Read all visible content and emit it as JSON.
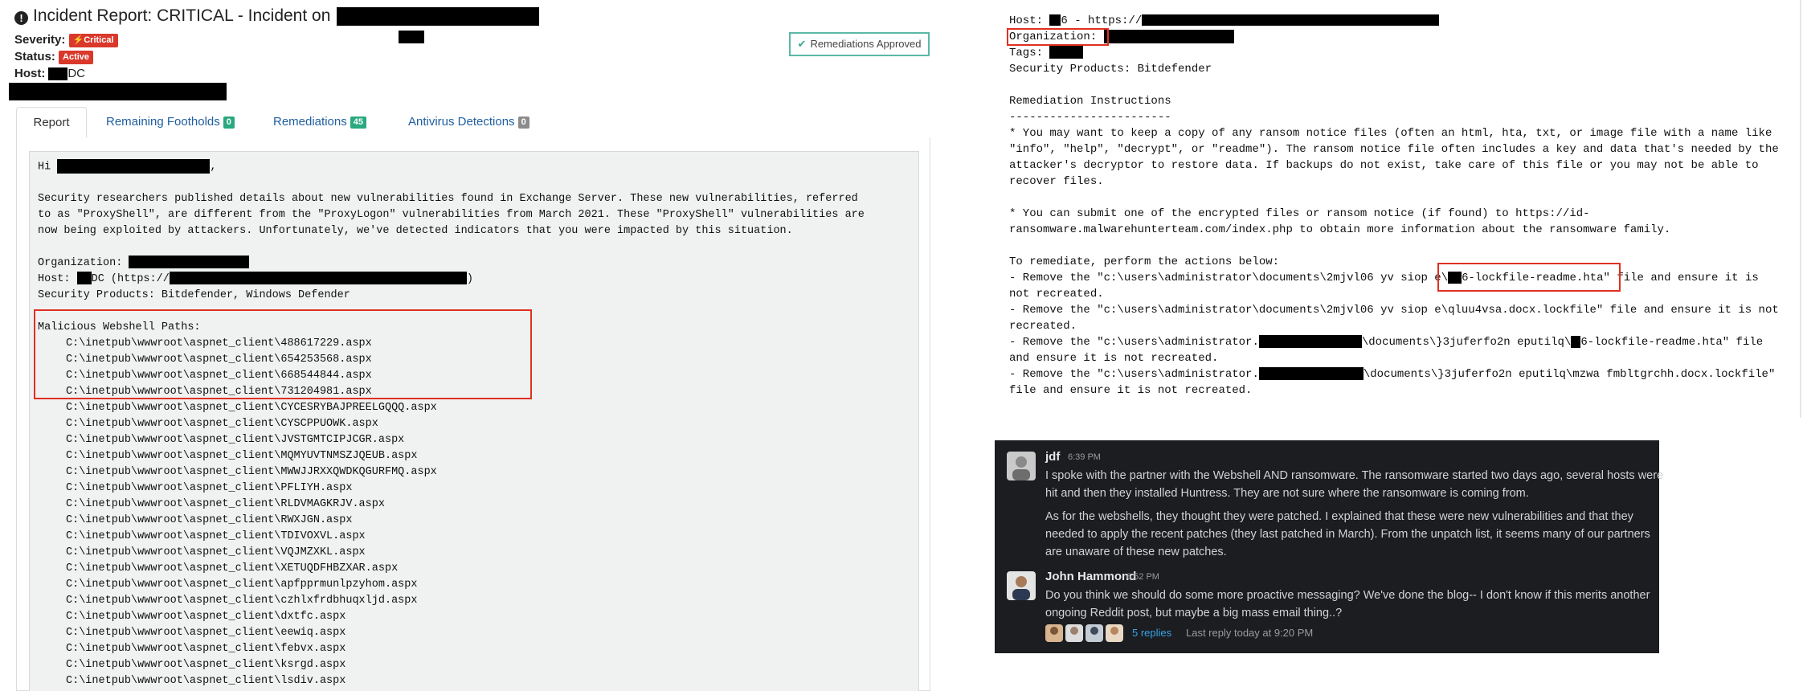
{
  "left": {
    "title_prefix": "Incident Report: CRITICAL - Incident on",
    "severity_label": "Severity:",
    "severity_badge": "⚡Critical",
    "status_label": "Status:",
    "status_badge": "Active",
    "host_label": "Host:",
    "host_suffix": "DC",
    "approved_label": "Remediations Approved",
    "tabs": [
      {
        "label": "Report"
      },
      {
        "label": "Remaining Footholds",
        "count": "0"
      },
      {
        "label": "Remediations",
        "count": "45"
      },
      {
        "label": "Antivirus Detections",
        "count": "0"
      }
    ],
    "report": {
      "greeting": "Hi",
      "para": [
        "Security researchers published details about new vulnerabilities found in Exchange Server. These new vulnerabilities, referred",
        "to as \"ProxyShell\", are different from the \"ProxyLogon\" vulnerabilities from March 2021. These \"ProxyShell\" vulnerabilities are",
        "now being exploited by attackers. Unfortunately, we've detected indicators that you were impacted by this situation."
      ],
      "org_label": "Organization:",
      "host_label": "Host:",
      "host_mid": "DC (https://",
      "products": "Security Products: Bitdefender, Windows Defender",
      "webshell_header": "Malicious Webshell Paths:",
      "paths": [
        "C:\\inetpub\\wwwroot\\aspnet_client\\488617229.aspx",
        "C:\\inetpub\\wwwroot\\aspnet_client\\654253568.aspx",
        "C:\\inetpub\\wwwroot\\aspnet_client\\668544844.aspx",
        "C:\\inetpub\\wwwroot\\aspnet_client\\731204981.aspx",
        "C:\\inetpub\\wwwroot\\aspnet_client\\CYCESRYBAJPREELGQQQ.aspx",
        "C:\\inetpub\\wwwroot\\aspnet_client\\CYSCPPUOWK.aspx",
        "C:\\inetpub\\wwwroot\\aspnet_client\\JVSTGMTCIPJCGR.aspx",
        "C:\\inetpub\\wwwroot\\aspnet_client\\MQMYUVTNMSZJQEUB.aspx",
        "C:\\inetpub\\wwwroot\\aspnet_client\\MWWJJRXXQWDKQGURFMQ.aspx",
        "C:\\inetpub\\wwwroot\\aspnet_client\\PFLIYH.aspx",
        "C:\\inetpub\\wwwroot\\aspnet_client\\RLDVMAGKRJV.aspx",
        "C:\\inetpub\\wwwroot\\aspnet_client\\RWXJGN.aspx",
        "C:\\inetpub\\wwwroot\\aspnet_client\\TDIVOXVL.aspx",
        "C:\\inetpub\\wwwroot\\aspnet_client\\VQJMZXKL.aspx",
        "C:\\inetpub\\wwwroot\\aspnet_client\\XETUQDFHBZXAR.aspx",
        "C:\\inetpub\\wwwroot\\aspnet_client\\apfpprmunlpzyhom.aspx",
        "C:\\inetpub\\wwwroot\\aspnet_client\\czhlxfrdbhuqxljd.aspx",
        "C:\\inetpub\\wwwroot\\aspnet_client\\dxtfc.aspx",
        "C:\\inetpub\\wwwroot\\aspnet_client\\eewiq.aspx",
        "C:\\inetpub\\wwwroot\\aspnet_client\\febvx.aspx",
        "C:\\inetpub\\wwwroot\\aspnet_client\\ksrgd.aspx",
        "C:\\inetpub\\wwwroot\\aspnet_client\\lsdiv.aspx"
      ]
    }
  },
  "right": {
    "host_prefix": "Host: ",
    "host_mid": "6 - https://",
    "org_label": "Organization: ",
    "tags_label": "Tags: ",
    "products": "Security Products: Bitdefender",
    "rem_title": "Remediation Instructions",
    "rem_rule": "------------------------",
    "bullet1": [
      "* You may want to keep a copy of any ransom notice files (often an html, hta, txt, or image file with a name like",
      "\"info\", \"help\", \"decrypt\", or \"readme\"). The ransom notice file often includes a key and data that's needed by the",
      "attacker's decryptor to restore data. If backups do not exist, take care of this file or you may not be able to",
      "recover files."
    ],
    "bullet2": [
      "* You can submit one of the encrypted files or ransom notice (if found) to https://id-",
      "ransomware.malwarehunterteam.com/index.php to obtain more information about the ransomware family."
    ],
    "remediate_intro": "To remediate, perform the actions below:",
    "r1a": "- Remove the \"c:\\users\\administrator\\documents\\2mjvl06 yv siop e\\",
    "r1b": "6-lockfile-readme.hta\" file and ensure it is",
    "r1c": "not recreated.",
    "r2a": "- Remove the \"c:\\users\\administrator\\documents\\2mjvl06 yv siop e\\qluu4vsa.docx.lockfile\" file and ensure it is not",
    "r2b": "recreated.",
    "r3a": "- Remove the \"c:\\users\\administrator.",
    "r3b": "\\documents\\}3juferfo2n eputilq\\",
    "r3c": "6-lockfile-readme.hta\" file",
    "r3d": "and ensure it is not recreated.",
    "r4a": "- Remove the \"c:\\users\\administrator.",
    "r4b": "\\documents\\}3juferfo2n eputilq\\mzwa fmbltgrchh.docx.lockfile\"",
    "r4c": "file and ensure it is not recreated."
  },
  "chat": {
    "m1_user": "jdf",
    "m1_time": "6:39 PM",
    "m1_p1": "I spoke with the partner with the Webshell AND ransomware. The ransomware started two days ago, several hosts were hit and then they installed Huntress. They are not sure where the ransomware is coming from.",
    "m1_p2": "As for the webshells, they thought they were patched. I explained that these were new vulnerabilities and that they needed to apply the recent patches (they last patched in March). From the unpatch list, it seems many of our partners are unaware of these new patches.",
    "m2_user": "John Hammond",
    "m2_time": "6:52 PM",
    "m2_text": "Do you think we should do some more proactive messaging? We've done the blog-- I don't know if this merits another ongoing Reddit post, but maybe a big mass email thing..?",
    "replies": "5 replies",
    "last_reply": "Last reply today at 9:20 PM",
    "colors": {
      "background": "#1b1d21",
      "link": "#36a4e5"
    }
  }
}
